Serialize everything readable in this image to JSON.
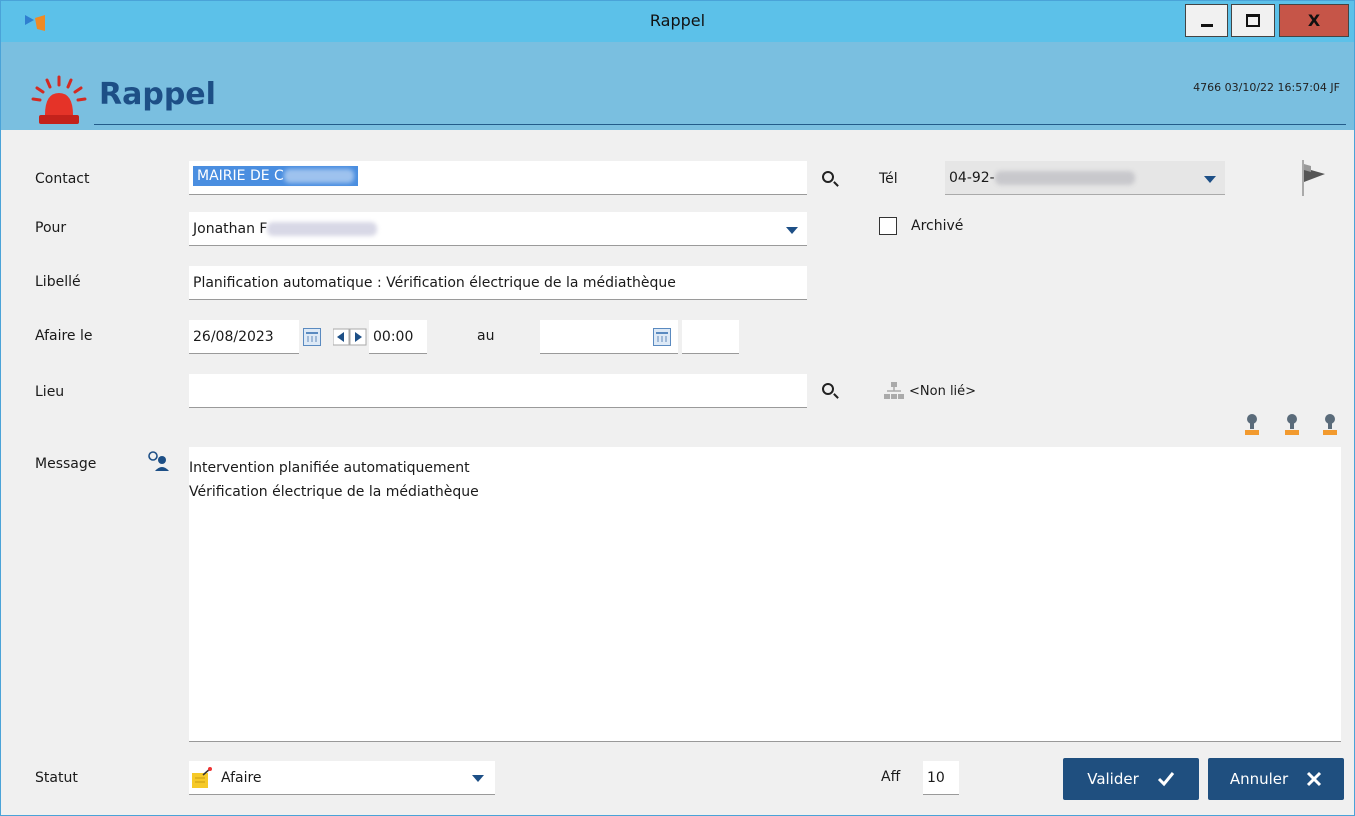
{
  "window": {
    "title": "Rappel"
  },
  "window_buttons": {
    "minimize": "minimize",
    "maximize": "maximize",
    "close": "X"
  },
  "header": {
    "title": "Rappel",
    "meta": "4766 03/10/22 16:57:04 JF"
  },
  "form": {
    "contact": {
      "label": "Contact",
      "value": "MAIRIE DE C"
    },
    "tel": {
      "label": "Tél",
      "value": "04-92-"
    },
    "pour": {
      "label": "Pour",
      "value": "Jonathan F"
    },
    "archive": {
      "label": "Archivé",
      "checked": false
    },
    "libelle": {
      "label": "Libellé",
      "value": "Planification automatique : Vérification électrique de la médiathèque"
    },
    "afaire": {
      "label": "Afaire le",
      "date": "26/08/2023",
      "time": "00:00",
      "au_label": "au",
      "end_date": "",
      "end_time": ""
    },
    "lieu": {
      "label": "Lieu",
      "value": "",
      "link_text": "<Non lié>"
    },
    "message": {
      "label": "Message",
      "line1": "Intervention planifiée automatiquement",
      "line2": "Vérification électrique de la médiathèque"
    },
    "statut": {
      "label": "Statut",
      "value": "Afaire"
    },
    "aff": {
      "label": "Aff",
      "value": "10"
    }
  },
  "buttons": {
    "valider": "Valider",
    "annuler": "Annuler"
  },
  "colors": {
    "titlebar": "#5cc1e9",
    "header": "#7abfe0",
    "accent": "#1d4f86",
    "button": "#1f4f7f",
    "close": "#c65548"
  }
}
